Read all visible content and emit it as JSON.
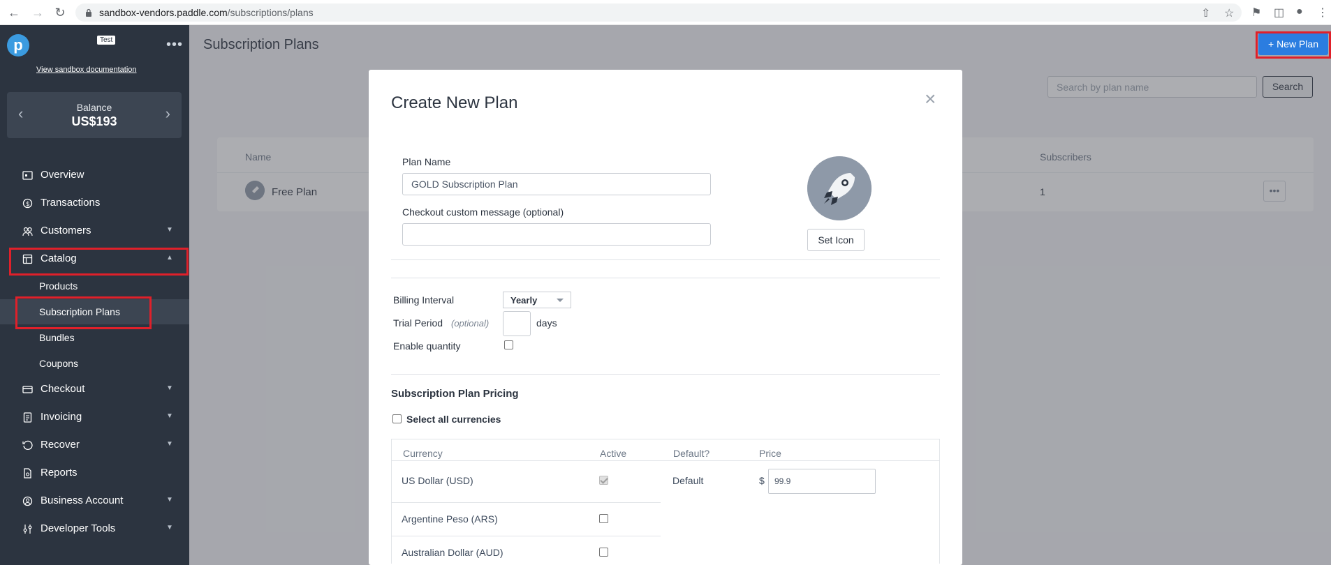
{
  "browser": {
    "url_host": "sandbox-vendors.paddle.com",
    "url_path": "/subscriptions/plans"
  },
  "sidebar": {
    "logo_letter": "p",
    "env_badge": "Test",
    "sandbox_link": "View sandbox documentation",
    "balance_label": "Balance",
    "balance_value": "US$193",
    "items": [
      {
        "label": "Overview"
      },
      {
        "label": "Transactions"
      },
      {
        "label": "Customers"
      },
      {
        "label": "Catalog"
      },
      {
        "label": "Checkout"
      },
      {
        "label": "Invoicing"
      },
      {
        "label": "Recover"
      },
      {
        "label": "Reports"
      },
      {
        "label": "Business Account"
      },
      {
        "label": "Developer Tools"
      }
    ],
    "catalog_sub": [
      {
        "label": "Products"
      },
      {
        "label": "Subscription Plans"
      },
      {
        "label": "Bundles"
      },
      {
        "label": "Coupons"
      }
    ]
  },
  "page": {
    "title": "Subscription Plans",
    "new_plan_label": "+ New Plan",
    "search_placeholder": "Search by plan name",
    "search_button": "Search",
    "table": {
      "col_name": "Name",
      "col_subscribers": "Subscribers",
      "rows": [
        {
          "name": "Free Plan",
          "subscribers": "1"
        }
      ]
    }
  },
  "modal": {
    "title": "Create New Plan",
    "plan_name_label": "Plan Name",
    "plan_name_value": "GOLD Subscription Plan",
    "checkout_msg_label": "Checkout custom message (optional)",
    "checkout_msg_value": "",
    "set_icon_label": "Set Icon",
    "billing_interval_label": "Billing Interval",
    "billing_interval_value": "Yearly",
    "trial_period_label": "Trial Period",
    "trial_optional": "(optional)",
    "trial_unit": "days",
    "enable_quantity_label": "Enable quantity",
    "pricing_title": "Subscription Plan Pricing",
    "select_all_label": "Select all currencies",
    "currency_headers": {
      "currency": "Currency",
      "active": "Active",
      "default": "Default?",
      "price": "Price"
    },
    "currencies": [
      {
        "name": "US Dollar (USD)",
        "default": "Default",
        "symbol": "$",
        "price": "99.9"
      },
      {
        "name": "Argentine Peso (ARS)"
      },
      {
        "name": "Australian Dollar (AUD)"
      }
    ]
  },
  "colors": {
    "sidebar_bg": "#2c3440",
    "accent_blue": "#2b7de0",
    "highlight_red": "#e0202a"
  }
}
